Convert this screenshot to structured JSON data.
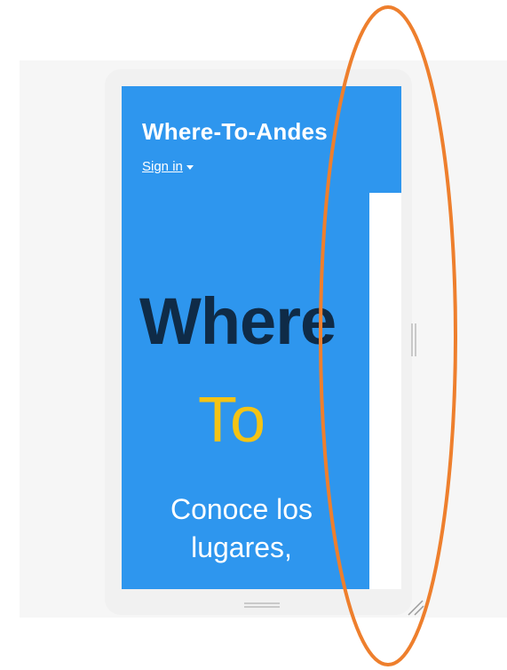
{
  "preview": {
    "brand": "Where-To-Andes",
    "signin_label": "Sign in",
    "hero_line1": "Where",
    "hero_line2": "To",
    "hero_subtitle_line1": "Conoce los",
    "hero_subtitle_line2": "lugares,"
  },
  "colors": {
    "page_background": "#ffffff",
    "stage_background": "#f6f6f6",
    "device_frame": "#f1f1f1",
    "viewport_blue": "#2e96ee",
    "hero_dark": "#0f2b47",
    "hero_yellow": "#f4c314",
    "annotation_orange": "#ee7f2d",
    "handle_gray": "#c9c9c9"
  },
  "icons": {
    "signin_caret": "caret-down-icon",
    "side_handle": "vertical-resize-handle-icon",
    "bottom_handle": "horizontal-resize-handle-icon",
    "corner_grip": "resize-corner-icon"
  }
}
